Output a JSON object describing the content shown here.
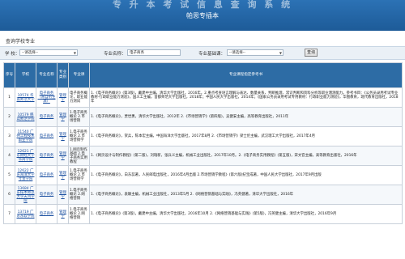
{
  "banner": {
    "title_faded": "专 升 本 考 试 信 息 查 询 系 统",
    "subtitle": "帕思专插本"
  },
  "section_title": "查询学校专业",
  "filters": {
    "school_label": "学 校：",
    "school_value": "--请选择--",
    "major_label": "专业名称：",
    "major_value": "电子商务",
    "category_label": "专业基础课：",
    "category_value": "--请选择--",
    "query_label": "查询"
  },
  "table": {
    "headers": [
      "序号",
      "学校",
      "专业名称",
      "专业类别",
      "专业课",
      "专业课程指定参考书"
    ],
    "rows": [
      {
        "no": "1",
        "school": "10574 华南师范大学",
        "major": "电子商务（限自招生源）",
        "category": "管理学",
        "course": "电子商务概论，职业能力测试",
        "books": "1.《电子商务概论》(第3版)，戴建中主编，清华大学出版社，2016年。2.重点考查语言理解与表达、数量关系、判断推理、常识判断和资料分析等职业潜测能力。参考书目：《公务员录用考试专业教材·行政职业能力测验》，国义工主编，首都师范大学出版社，2018年；中国人民大学出版社，2014年；《国家公务员录用考试专用教材：行政职业能力测验》，华图教育，现代教育出版社，2018年"
      },
      {
        "no": "2",
        "school": "10579 韩山师范学院",
        "major": "电子商务",
        "category": "管理学",
        "course": "1.电子商务概论 2.市场营销",
        "books": "1.《电子商务概论》，贾世勇，清华大学出版社，2012年 2.《市场营销学》(第四版)，吴健安主编，高等教育出版社，2011年"
      },
      {
        "no": "3",
        "school": "11540 广州工程技术职业学院",
        "major": "电子商务",
        "category": "管理学",
        "course": "1.电子商务概论 2.市场营销学",
        "books": "1.《电子商务概论》，贺兵，陈本宏主编，中国海洋大学出版社，2017年8月 2.《市场营销学》梁士伦主编，武汉理工大学出版社，2017年4月"
      },
      {
        "no": "4",
        "school": "12621 广东财经大学华商学院",
        "major": "电子商务",
        "category": "管理学",
        "course": "1.网页制作基础 2.电子商务实用教程",
        "books": "1.《网页设计与制作教程》(第二版)，刘瑞新，张兵义主编，机械工业出版社，2017年10月。2.《电子商务实用教程》(第五版)，宋文官主编，高等教育出版社，2016年"
      },
      {
        "no": "5",
        "school": "12622 广东海洋大学寸金学院",
        "major": "电子商务",
        "category": "管理学",
        "course": "1.电子商务概论 2.市场营销学",
        "books": "1.《电子商务概论》，白东蕊著，人民邮电出版社，2016年4月出版 2.市场营销学教程》(第六版)纪宝成著，中国人民大学出版社，2017年9月出版"
      },
      {
        "no": "6",
        "school": "13684 广东技术师范大学天河学院",
        "major": "电子商务",
        "category": "管理学",
        "course": "1.电子商务概论 2.网络营销",
        "books": "1.《电子商务概论》，袁颖主编，机械工业出版社，2013年5月 2.《网络营销基础与实践》，冯英健著，清华大学出版社，2016年"
      },
      {
        "no": "7",
        "school": "13719 广东东软学院",
        "major": "电子商务",
        "category": "管理学",
        "course": "1.电子商务概论 2.网络营销",
        "books": "1.《电子商务概论》(第3版)，戴建中主编，清华大学出版社，2016年10月 2.《网络营销基础与实践》(第5版)，冯英健主编，清华大学出版社，2016年9月"
      }
    ]
  }
}
